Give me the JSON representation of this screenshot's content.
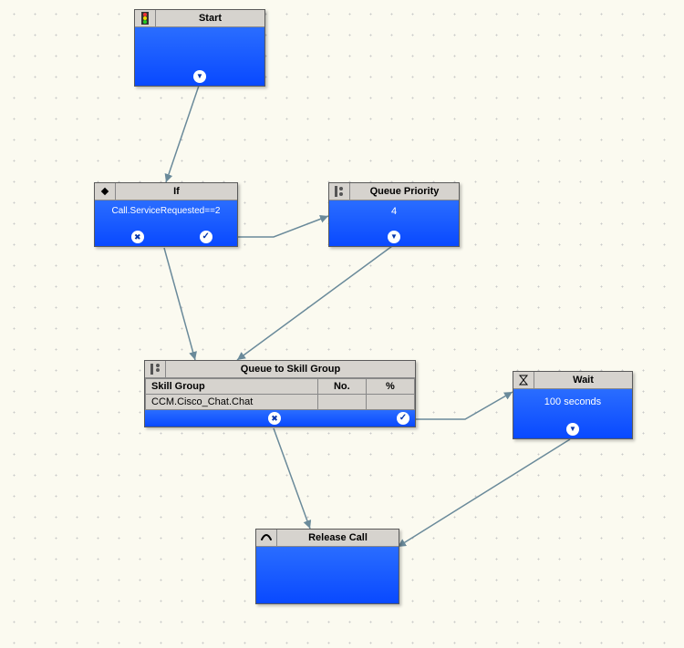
{
  "nodes": {
    "start": {
      "title": "Start"
    },
    "if_node": {
      "title": "If",
      "condition": "Call.ServiceRequested==2"
    },
    "queue_priority": {
      "title": "Queue Priority",
      "value": "4"
    },
    "queue_skill": {
      "title": "Queue to Skill Group",
      "columns": {
        "skill_group": "Skill Group",
        "no": "No.",
        "pct": "%"
      },
      "row": {
        "skill_group": "CCM.Cisco_Chat.Chat",
        "no": "",
        "pct": ""
      }
    },
    "wait": {
      "title": "Wait",
      "value": "100 seconds"
    },
    "release": {
      "title": "Release Call"
    }
  }
}
